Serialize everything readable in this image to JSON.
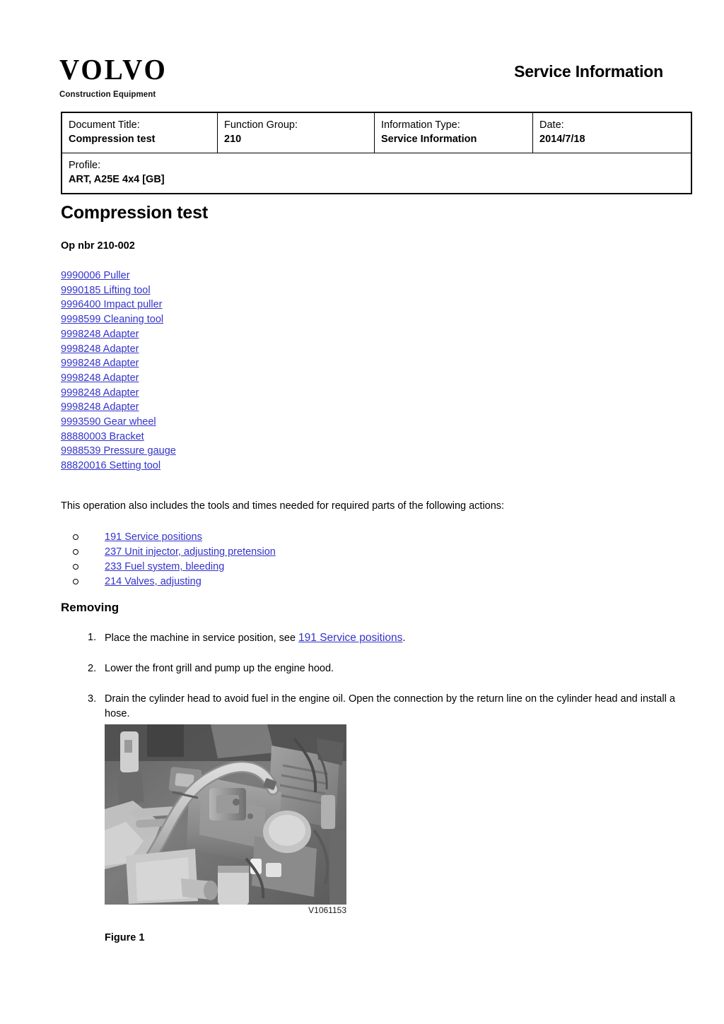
{
  "header": {
    "logo_text": "VOLVO",
    "logo_subtitle": "Construction Equipment",
    "title": "Service Information"
  },
  "info_table": {
    "row1": [
      {
        "label": "Document Title:",
        "value": "Compression test"
      },
      {
        "label": "Function Group:",
        "value": "210"
      },
      {
        "label": "Information Type:",
        "value": "Service Information"
      },
      {
        "label": "Date:",
        "value": "2014/7/18"
      }
    ],
    "row2": {
      "label": "Profile:",
      "value": "ART, A25E 4x4 [GB]"
    }
  },
  "document": {
    "title": "Compression test",
    "op_nbr": "Op nbr 210-002",
    "tools": [
      "9990006 Puller",
      "9990185 Lifting tool",
      "9996400 Impact puller",
      "9998599 Cleaning tool",
      "9998248 Adapter",
      "9998248 Adapter",
      "9998248 Adapter",
      "9998248 Adapter",
      "9998248 Adapter",
      "9998248 Adapter",
      "9993590 Gear wheel",
      "88880003 Bracket",
      "9988539 Pressure gauge",
      "88820016 Setting tool"
    ],
    "intro_text": "This operation also includes the tools and times needed for required parts of the following actions:",
    "related_actions": [
      "191 Service positions",
      "237 Unit injector, adjusting pretension",
      "233 Fuel system, bleeding",
      "214 Valves, adjusting"
    ],
    "section_heading": "Removing",
    "steps": [
      {
        "number": "1.",
        "text_before": "Place the machine in service position, see ",
        "link": "191 Service positions",
        "text_after": "."
      },
      {
        "number": "2.",
        "text_before": "Lower the front grill and pump up the engine hood.",
        "link": "",
        "text_after": ""
      },
      {
        "number": "3.",
        "text_before": "Drain the cylinder head to avoid fuel in the engine oil. Open the connection by the return line on the cylinder head and install a hose.",
        "link": "",
        "text_after": ""
      }
    ],
    "figure": {
      "image_id": "V1061153",
      "caption": "Figure 1",
      "alt": "Grayscale photo of an engine cylinder head with a hose installed on the return line connection"
    }
  },
  "colors": {
    "link": "#3333cc",
    "text": "#000000",
    "background": "#ffffff"
  }
}
